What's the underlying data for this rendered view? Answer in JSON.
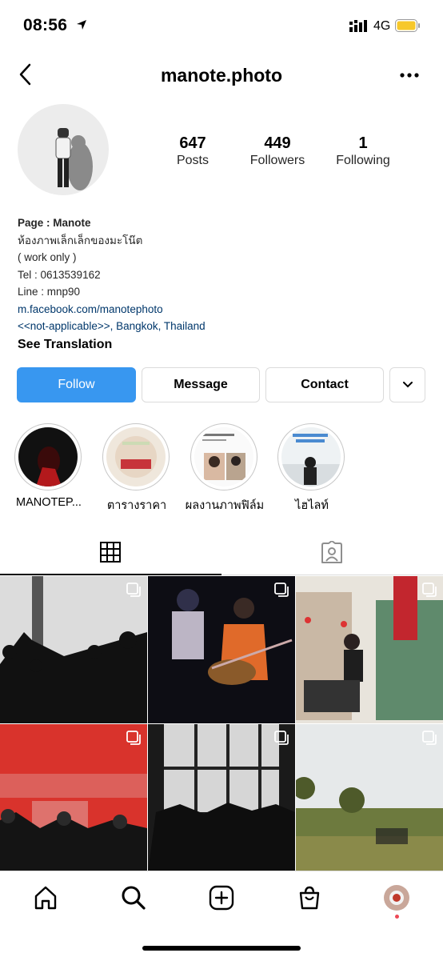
{
  "status_bar": {
    "time": "08:56",
    "network": "4G"
  },
  "header": {
    "username": "manote.photo"
  },
  "stats": [
    {
      "count": "647",
      "label": "Posts"
    },
    {
      "count": "449",
      "label": "Followers"
    },
    {
      "count": "1",
      "label": "Following"
    }
  ],
  "bio": {
    "name": "Page : Manote",
    "line1": "ห้องภาพเล็กเล็กของมะโน๊ต",
    "line2": "( work only )",
    "line3": "Tel : 0613539162",
    "line4": "Line : mnp90",
    "website": "m.facebook.com/manotephoto",
    "location": "<<not-applicable>>, Bangkok, Thailand",
    "see_translation": "See Translation"
  },
  "actions": {
    "follow": "Follow",
    "message": "Message",
    "contact": "Contact"
  },
  "highlights": [
    {
      "label": "MANOTEP..."
    },
    {
      "label": "ตารางราคา"
    },
    {
      "label": "ผลงานภาพฟิล์ม"
    },
    {
      "label": "ไฮไลท์"
    }
  ],
  "colors": {
    "follow_button": "#3897f0",
    "link": "#00376b",
    "notification_dot": "#ed4956"
  },
  "icons": [
    "location-arrow-icon",
    "signal-icon",
    "battery-icon",
    "back-icon",
    "more-icon",
    "chevron-down-icon",
    "grid-icon",
    "tagged-icon",
    "home-icon",
    "search-icon",
    "new-post-icon",
    "shop-icon",
    "profile-avatar-icon",
    "multi-photo-icon"
  ]
}
